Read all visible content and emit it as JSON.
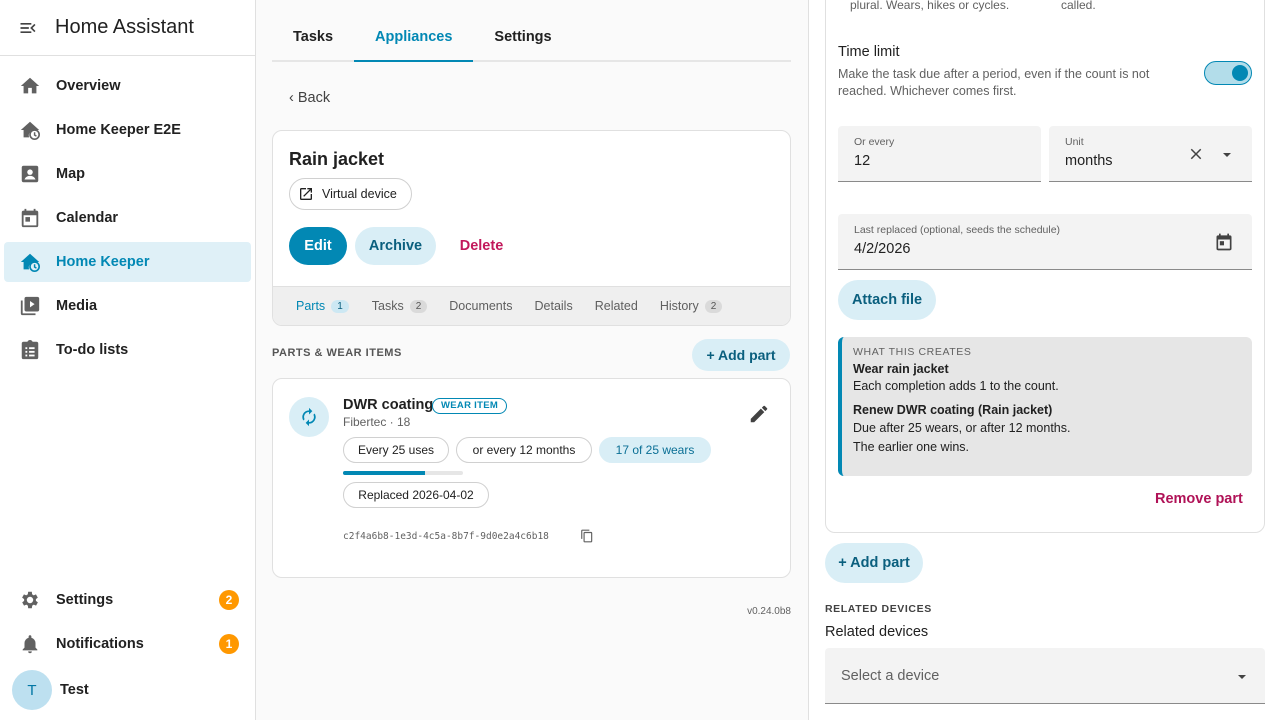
{
  "app": {
    "title": "Home Assistant"
  },
  "sidebar": {
    "items": [
      {
        "label": "Overview",
        "icon": "home-icon"
      },
      {
        "label": "Home Keeper E2E",
        "icon": "home-clock-icon"
      },
      {
        "label": "Map",
        "icon": "map-account-icon"
      },
      {
        "label": "Calendar",
        "icon": "calendar-icon"
      },
      {
        "label": "Home Keeper",
        "icon": "home-clock-icon",
        "active": true
      },
      {
        "label": "Media",
        "icon": "media-icon"
      },
      {
        "label": "To-do lists",
        "icon": "clipboard-list-icon"
      }
    ],
    "settings": {
      "label": "Settings",
      "badge": "2"
    },
    "notifications": {
      "label": "Notifications",
      "badge": "1"
    },
    "user": {
      "initial": "T",
      "name": "Test"
    }
  },
  "main": {
    "tabs": [
      "Tasks",
      "Appliances",
      "Settings"
    ],
    "active_tab": "Appliances",
    "back_label": "‹ Back",
    "device": {
      "title": "Rain jacket",
      "virtual_chip": "Virtual device",
      "edit": "Edit",
      "archive": "Archive",
      "delete": "Delete"
    },
    "subtabs": [
      {
        "label": "Parts",
        "count": "1"
      },
      {
        "label": "Tasks",
        "count": "2"
      },
      {
        "label": "Documents"
      },
      {
        "label": "Details"
      },
      {
        "label": "Related"
      },
      {
        "label": "History",
        "count": "2"
      }
    ],
    "section_title": "PARTS & WEAR ITEMS",
    "add_part": "+ Add part",
    "part": {
      "name": "DWR coating",
      "badge": "WEAR ITEM",
      "subtitle": "Fibertec · 18",
      "chip_uses": "Every 25 uses",
      "chip_months": "or every 12 months",
      "chip_progress": "17 of 25 wears",
      "progress": 0.68,
      "chip_replaced": "Replaced 2026-04-02",
      "uuid": "c2f4a6b8-1e3d-4c5a-8b7f-9d0e2a4c6b18"
    },
    "version": "v0.24.0b8"
  },
  "panel": {
    "overflow_left": "plural. Wears, hikes or cycles.",
    "overflow_right": "called.",
    "time_limit_label": "Time limit",
    "time_limit_desc": "Make the task due after a period, even if the count is not reached. Whichever comes first.",
    "time_limit_on": true,
    "or_every_label": "Or every",
    "or_every_value": "12",
    "unit_label": "Unit",
    "unit_value": "months",
    "last_replaced_label": "Last replaced (optional, seeds the schedule)",
    "last_replaced_value": "4/2/2026",
    "attach_file": "Attach file",
    "info": {
      "heading": "WHAT THIS CREATES",
      "b1_title": "Wear rain jacket",
      "b1_text": "Each completion adds 1 to the count.",
      "b2_title": "Renew DWR coating (Rain jacket)",
      "b2_line1": "Due after 25 wears, or after 12 months.",
      "b2_line2": "The earlier one wins."
    },
    "remove_part": "Remove part",
    "add_part": "+ Add part",
    "related_heading": "RELATED DEVICES",
    "related_label": "Related devices",
    "select_placeholder": "Select a device"
  },
  "colors": {
    "accent": "#0288b4",
    "accent_light": "#d9eef6",
    "danger": "#c2185b",
    "badge": "#ff9800"
  }
}
